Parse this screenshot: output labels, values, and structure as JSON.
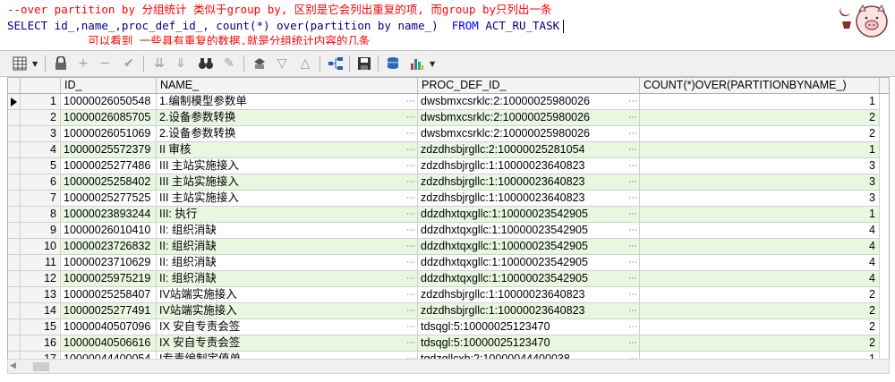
{
  "editor": {
    "line1": "--over partition by 分组统计 类似于group by, 区别是它会列出重复的项, 而group by只列出一条",
    "line2_pre": "SELECT id_,name_,proc_def_id_, count(*) over(partition by name_)  ",
    "line2_kw": "FROM",
    "line2_post": " ACT_RU_TASK",
    "line3": "            可以看到 一些具有重复的数据,就是分组统计内容的几条"
  },
  "colors": {
    "comment": "#ff0000",
    "keyword": "#0000ff",
    "even_row": "#e8f7e0"
  },
  "toolbar": {
    "icons": [
      "grid-icon",
      "lock-icon",
      "add-icon",
      "remove-icon",
      "check-icon",
      "down-arrows-icon",
      "down-arrows-2-icon",
      "binoculars-icon",
      "eraser-icon",
      "query-icon",
      "triangle-down-icon",
      "triangle-up-icon",
      "tree-icon",
      "save-icon",
      "db-icon",
      "chart-icon"
    ]
  },
  "grid": {
    "headers": [
      "ID_",
      "NAME_",
      "PROC_DEF_ID_",
      "COUNT(*)OVER(PARTITIONBYNAME_)"
    ],
    "rows": [
      {
        "n": "1",
        "id": "10000026050548",
        "name": "1.编制模型参数单",
        "proc": "dwsbmxcsrklc:2:10000025980026",
        "cnt": "1"
      },
      {
        "n": "2",
        "id": "10000026085705",
        "name": "2.设备参数转换",
        "proc": "dwsbmxcsrklc:2:10000025980026",
        "cnt": "2"
      },
      {
        "n": "3",
        "id": "10000026051069",
        "name": "2.设备参数转换",
        "proc": "dwsbmxcsrklc:2:10000025980026",
        "cnt": "2"
      },
      {
        "n": "4",
        "id": "10000025572379",
        "name": "II 审核",
        "proc": "zdzdhsbjrgllc:2:10000025281054",
        "cnt": "1"
      },
      {
        "n": "5",
        "id": "10000025277486",
        "name": "III 主站实施接入",
        "proc": "zdzdhsbjrgllc:1:10000023640823",
        "cnt": "3"
      },
      {
        "n": "6",
        "id": "10000025258402",
        "name": "III 主站实施接入",
        "proc": "zdzdhsbjrgllc:1:10000023640823",
        "cnt": "3"
      },
      {
        "n": "7",
        "id": "10000025277525",
        "name": "III 主站实施接入",
        "proc": "zdzdhsbjrgllc:1:10000023640823",
        "cnt": "3"
      },
      {
        "n": "8",
        "id": "10000023893244",
        "name": "III: 执行",
        "proc": "ddzdhxtqxgllc:1:10000023542905",
        "cnt": "1"
      },
      {
        "n": "9",
        "id": "10000026010410",
        "name": "II: 组织消缺",
        "proc": "ddzdhxtqxgllc:1:10000023542905",
        "cnt": "4"
      },
      {
        "n": "10",
        "id": "10000023726832",
        "name": "II: 组织消缺",
        "proc": "ddzdhxtqxgllc:1:10000023542905",
        "cnt": "4"
      },
      {
        "n": "11",
        "id": "10000023710629",
        "name": "II: 组织消缺",
        "proc": "ddzdhxtqxgllc:1:10000023542905",
        "cnt": "4"
      },
      {
        "n": "12",
        "id": "10000025975219",
        "name": "II: 组织消缺",
        "proc": "ddzdhxtqxgllc:1:10000023542905",
        "cnt": "4"
      },
      {
        "n": "13",
        "id": "10000025258407",
        "name": "IV站端实施接入",
        "proc": "zdzdhsbjrgllc:1:10000023640823",
        "cnt": "2"
      },
      {
        "n": "14",
        "id": "10000025277491",
        "name": "IV站端实施接入",
        "proc": "zdzdhsbjrgllc:1:10000023640823",
        "cnt": "2"
      },
      {
        "n": "15",
        "id": "10000040507096",
        "name": "IX 安自专责会签",
        "proc": "tdsqgl:5:10000025123470",
        "cnt": "2"
      },
      {
        "n": "16",
        "id": "10000040506616",
        "name": "IX 安自专责会签",
        "proc": "tdsqgl:5:10000025123470",
        "cnt": "2"
      },
      {
        "n": "17",
        "id": "10000044400054",
        "name": "I专责编制定值单",
        "proc": "tqdzgllcxb:2:10000044400038",
        "cnt": "1"
      }
    ]
  }
}
